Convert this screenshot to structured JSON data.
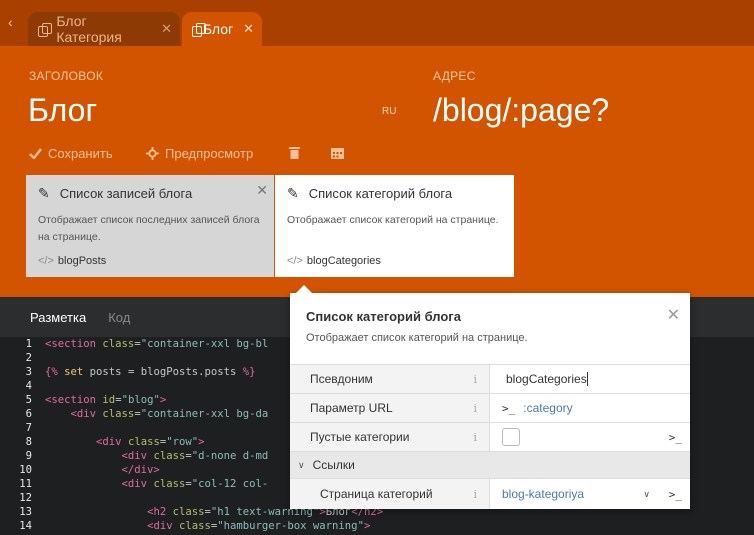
{
  "tabs": [
    {
      "label": "Блог Категория"
    },
    {
      "label": "Блог"
    }
  ],
  "header": {
    "title_label": "ЗАГОЛОВОК",
    "title_value": "Блог",
    "lang": "RU",
    "url_label": "АДРЕС",
    "url_value": "/blog/:page?"
  },
  "toolbar": {
    "save": "Сохранить",
    "preview": "Предпросмотр"
  },
  "components": [
    {
      "title": "Список записей блога",
      "desc_line1": "Отображает список последних записей блога",
      "desc_line2": "на странице.",
      "alias": "blogPosts"
    },
    {
      "title": "Список категорий блога",
      "desc_line1": "Отображает список категорий на странице.",
      "alias": "blogCategories"
    }
  ],
  "editor_tabs": {
    "markup": "Разметка",
    "code": "Код"
  },
  "code_lines": [
    "1",
    "2",
    "3",
    "4",
    "5",
    "6",
    "7",
    "8",
    "9",
    "10",
    "11",
    "12",
    "13",
    "14"
  ],
  "popup": {
    "title": "Список категорий блога",
    "desc": "Отображает список категорий на странице.",
    "rows": {
      "alias": {
        "label": "Псевдоним",
        "value": "blogCategories"
      },
      "url_param": {
        "label": "Параметр URL",
        "value": ":category"
      },
      "empty": {
        "label": "Пустые категории"
      },
      "links_group": "Ссылки",
      "category_page": {
        "label": "Страница категорий",
        "value": "blog-kategoriya"
      }
    },
    "term_symbol": ">_"
  },
  "colors": {
    "accent": "#d35400",
    "tabbar": "#a94000"
  }
}
